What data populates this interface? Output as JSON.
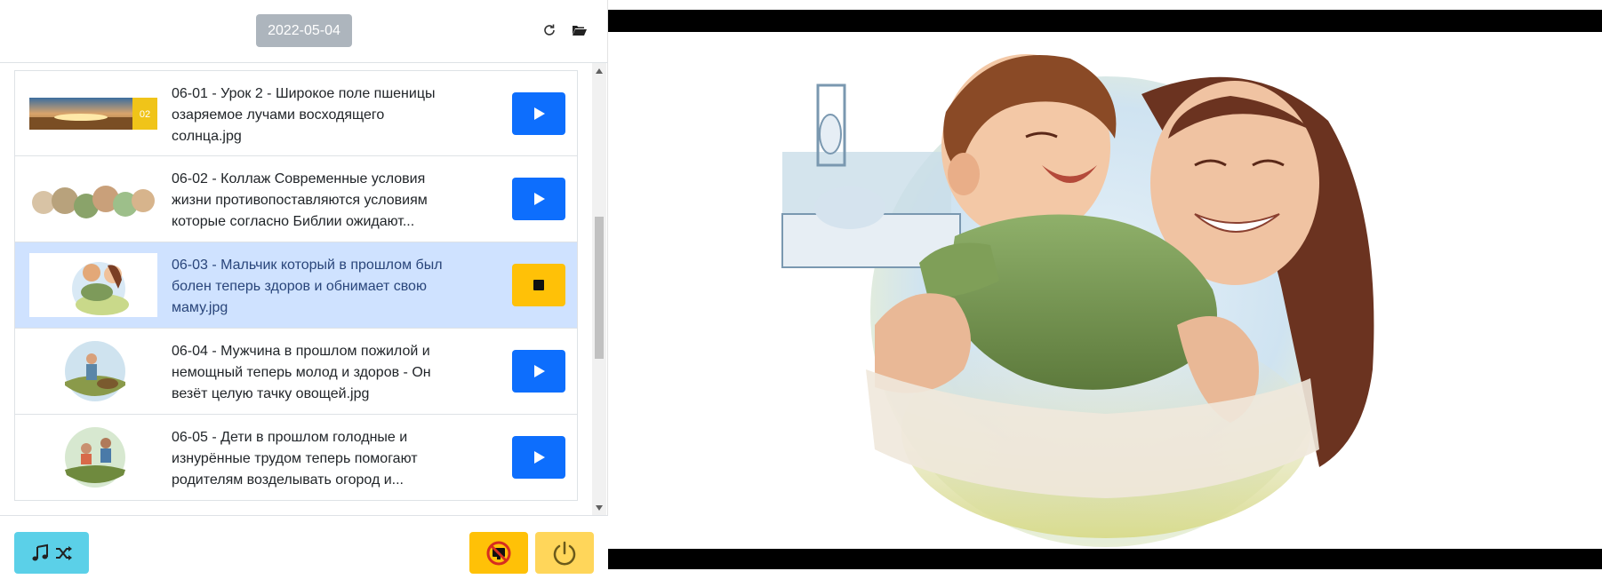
{
  "header": {
    "date": "2022-05-04",
    "refresh_icon": "refresh-icon",
    "folder_icon": "folder-open-icon"
  },
  "items": [
    {
      "title": "06-01 - Урок 2 - Широкое поле пшеницы озаряемое лучами восходящего солнца.jpg",
      "badge": "02",
      "state": "idle",
      "action_icon": "play-icon"
    },
    {
      "title": "06-02 - Коллаж Современные условия жизни противопоставляются условиям которые согласно Библии ожидают...",
      "state": "idle",
      "action_icon": "play-icon"
    },
    {
      "title": "06-03 - Мальчик который в прошлом был болен теперь здоров и обнимает свою маму.jpg",
      "state": "playing",
      "action_icon": "stop-icon"
    },
    {
      "title": "06-04 - Мужчина в прошлом пожилой и немощный теперь молод и здоров - Он везёт целую тачку овощей.jpg",
      "state": "idle",
      "action_icon": "play-icon"
    },
    {
      "title": "06-05 - Дети в прошлом голодные и изнурённые трудом теперь помогают родителям возделывать огород и...",
      "state": "idle",
      "action_icon": "play-icon"
    }
  ],
  "footer": {
    "music_icon": "music-note-icon",
    "shuffle_icon": "shuffle-icon",
    "screen_off_icon": "screen-off-icon",
    "power_icon": "power-icon"
  },
  "preview": {
    "image_subject": "boy hugging his smiling mother, hospital bed in background"
  },
  "colors": {
    "primary": "#0d6efd",
    "warning": "#ffc107",
    "info": "#5bd0e8",
    "active_row": "#cfe2ff",
    "date_button": "#adb5bd"
  }
}
